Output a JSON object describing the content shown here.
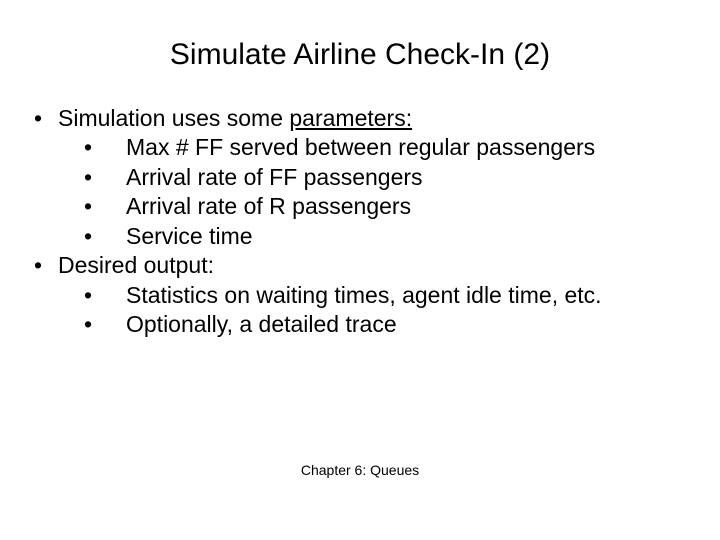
{
  "title": "Simulate Airline Check-In (2)",
  "item1_prefix": "Simulation uses some ",
  "item1_underlined": "parameters:",
  "sub1": {
    "a": "Max # FF served between regular passengers",
    "b": "Arrival rate of FF passengers",
    "c": "Arrival rate of R passengers",
    "d": "Service time"
  },
  "item2": "Desired output:",
  "sub2": {
    "a": "Statistics on waiting times, agent idle time, etc.",
    "b": "Optionally, a detailed trace"
  },
  "footer": "Chapter 6: Queues",
  "bullet": "•"
}
